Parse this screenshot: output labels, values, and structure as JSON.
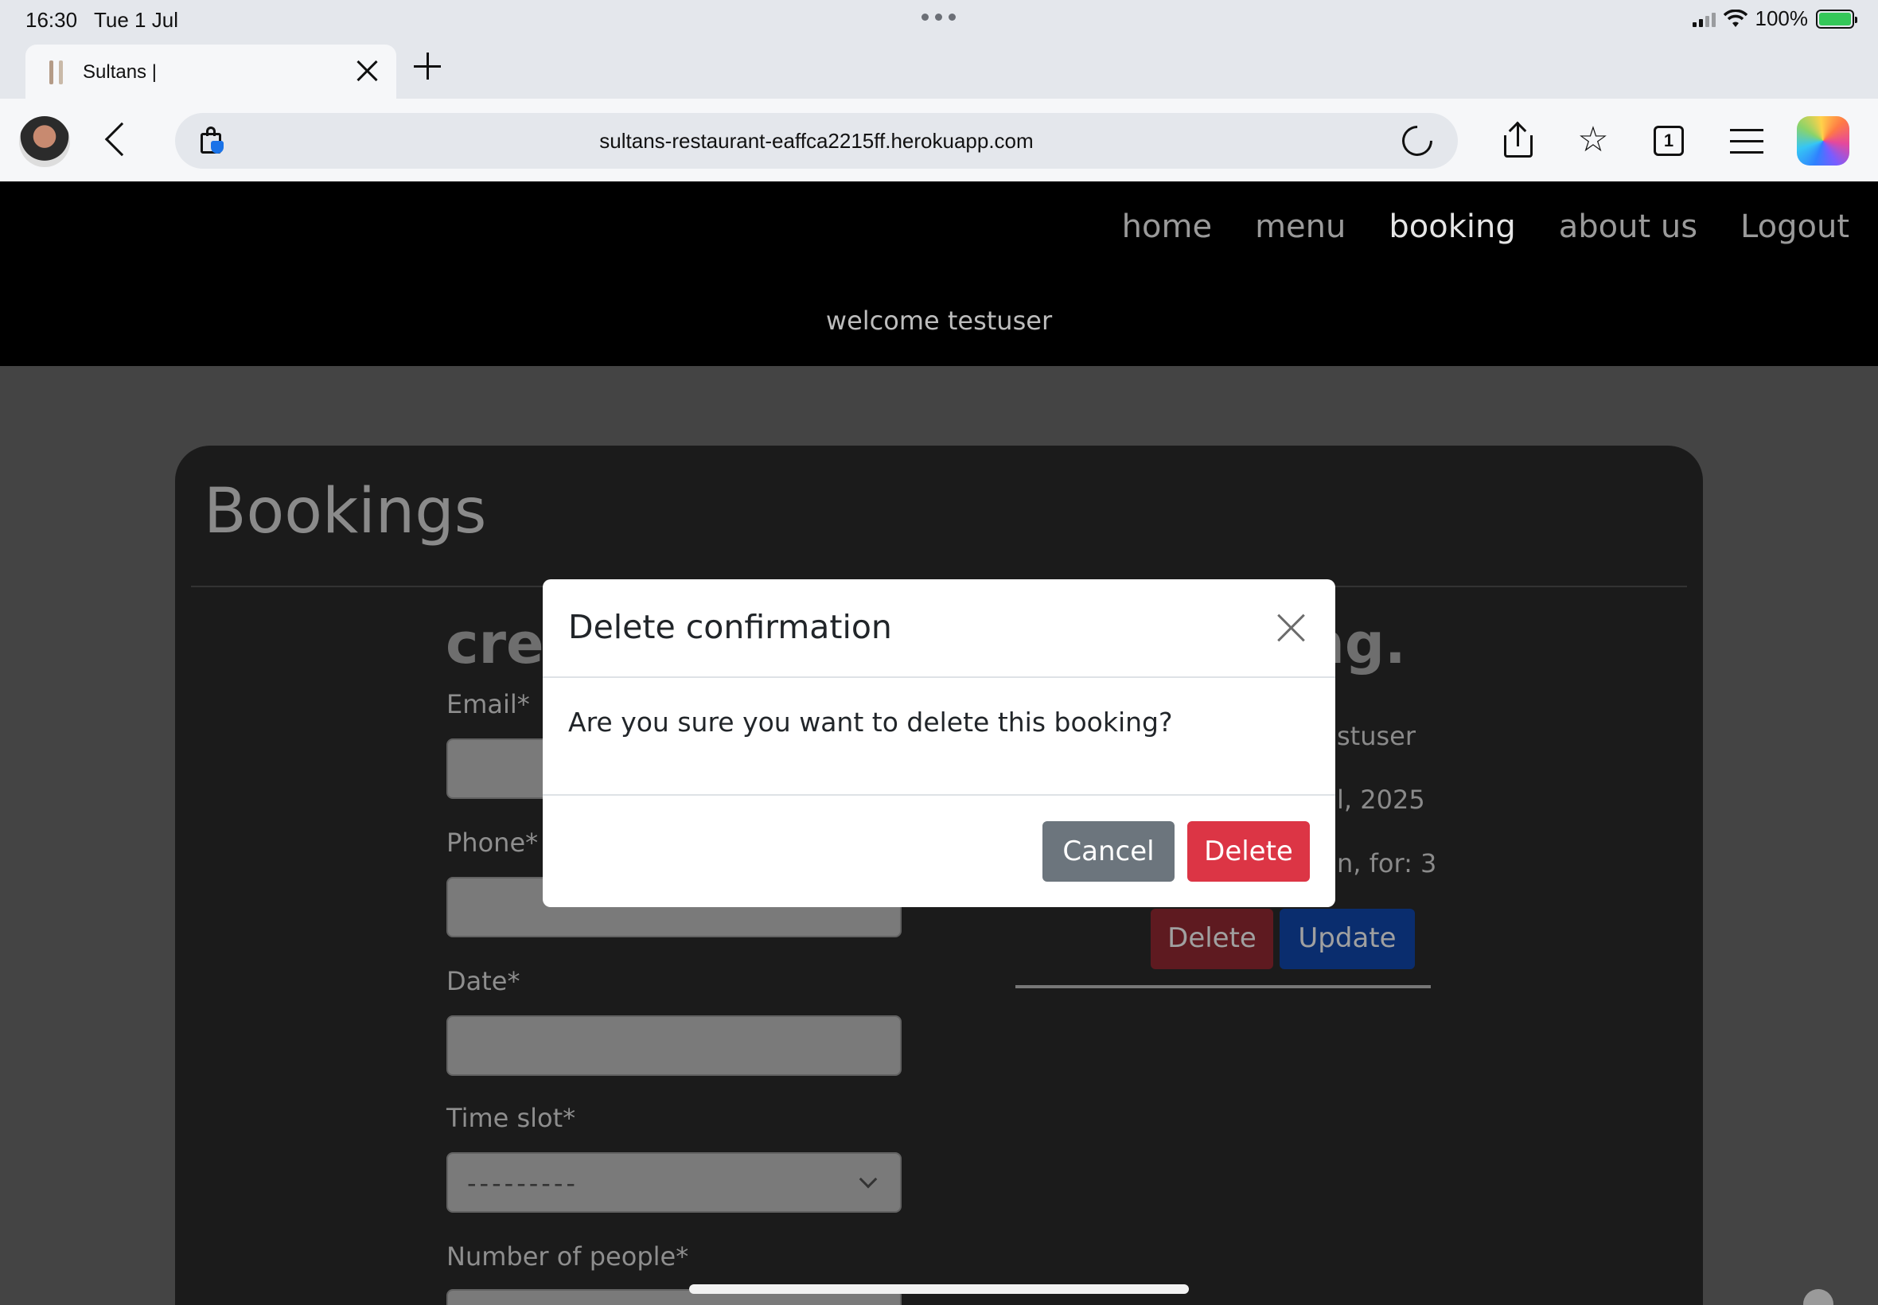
{
  "status_bar": {
    "time": "16:30",
    "date": "Tue 1 Jul",
    "battery": "100%"
  },
  "browser": {
    "tab_title": "Sultans |",
    "url": "sultans-restaurant-eaffca2215ff.herokuapp.com",
    "tab_count": "1",
    "star_glyph": "☆"
  },
  "nav": {
    "links": [
      "home",
      "menu",
      "booking",
      "about us",
      "Logout"
    ],
    "active": "booking",
    "welcome": "welcome testuser"
  },
  "page": {
    "title": "Bookings",
    "form_heading_partial": "cre",
    "right_heading_partial": "ng.",
    "fields": {
      "email": "Email*",
      "phone": "Phone*",
      "date": "Date*",
      "time_slot": "Time slot*",
      "time_slot_value": "---------",
      "people": "Number of people*"
    },
    "booking_info": [
      "stuser",
      "l, 2025",
      "n, for: 3"
    ],
    "delete_label": "Delete",
    "update_label": "Update"
  },
  "modal": {
    "title": "Delete confirmation",
    "body": "Are you sure you want to delete this booking?",
    "cancel_label": "Cancel",
    "delete_label": "Delete"
  },
  "colors": {
    "danger": "#dc3545",
    "secondary": "#6c757d",
    "primary": "#0d6efd",
    "nav_bg": "#000000"
  }
}
